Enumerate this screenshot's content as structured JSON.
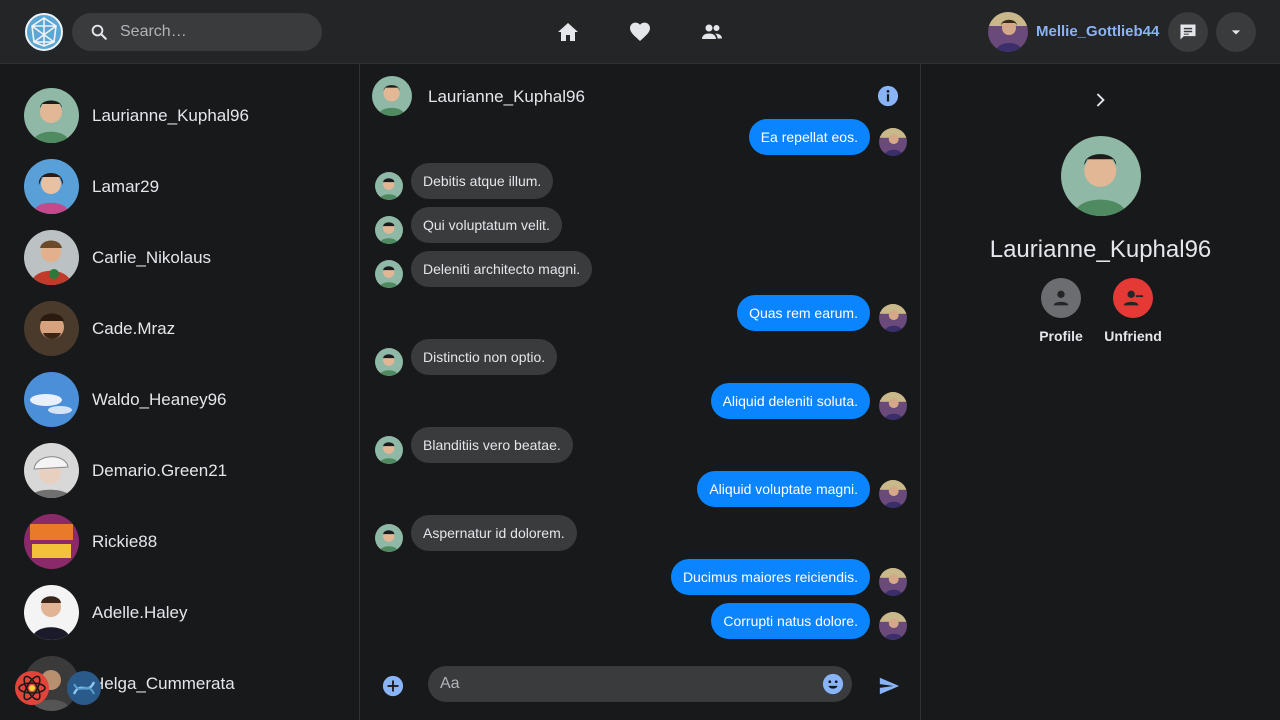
{
  "header": {
    "search_placeholder": "Search…",
    "user_name": "Mellie_Gottlieb44"
  },
  "friends": [
    {
      "name": "Laurianne_Kuphal96"
    },
    {
      "name": "Lamar29"
    },
    {
      "name": "Carlie_Nikolaus"
    },
    {
      "name": "Cade.Mraz"
    },
    {
      "name": "Waldo_Heaney96"
    },
    {
      "name": "Demario.Green21"
    },
    {
      "name": "Rickie88"
    },
    {
      "name": "Adelle.Haley"
    },
    {
      "name": "Helga_Cummerata"
    }
  ],
  "chat": {
    "contact_name": "Laurianne_Kuphal96",
    "messages": [
      {
        "direction": "out",
        "text": "Ea repellat eos."
      },
      {
        "direction": "in",
        "text": "Debitis atque illum."
      },
      {
        "direction": "in",
        "text": "Qui voluptatum velit."
      },
      {
        "direction": "in",
        "text": "Deleniti architecto magni."
      },
      {
        "direction": "out",
        "text": "Quas rem earum."
      },
      {
        "direction": "in",
        "text": "Distinctio non optio."
      },
      {
        "direction": "out",
        "text": "Aliquid deleniti soluta."
      },
      {
        "direction": "in",
        "text": "Blanditiis vero beatae."
      },
      {
        "direction": "out",
        "text": "Aliquid voluptate magni."
      },
      {
        "direction": "in",
        "text": "Aspernatur id dolorem."
      },
      {
        "direction": "out",
        "text": "Ducimus maiores reiciendis."
      },
      {
        "direction": "out",
        "text": "Corrupti natus dolore."
      }
    ],
    "composer_placeholder": "Aa"
  },
  "profile_panel": {
    "name": "Laurianne_Kuphal96",
    "profile_label": "Profile",
    "unfriend_label": "Unfriend"
  },
  "colors": {
    "background": "#18191a",
    "surface": "#242526",
    "bubble_in": "#3a3b3c",
    "bubble_out": "#0a84ff",
    "accent_link": "#8ab4f8",
    "unfriend_red": "#f02849"
  }
}
